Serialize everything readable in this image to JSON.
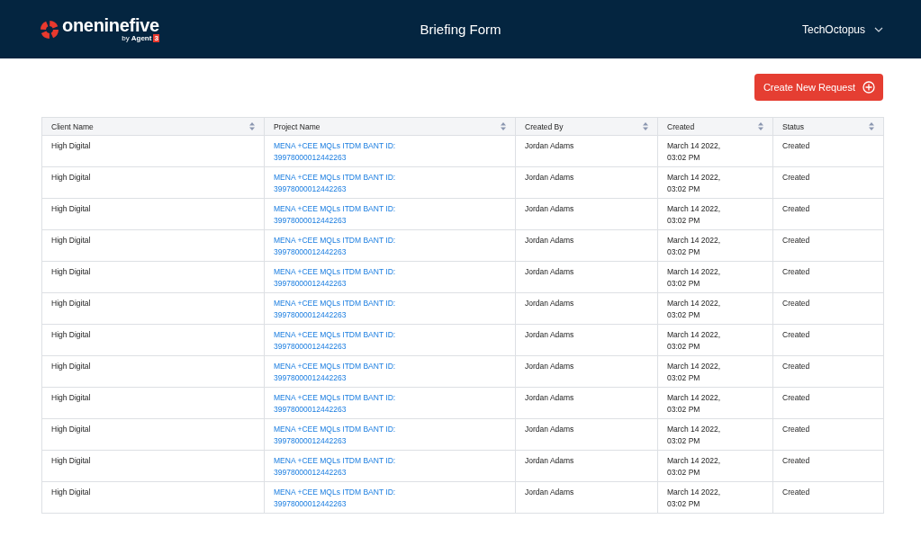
{
  "header": {
    "logo": {
      "wordmark": "oneninefive",
      "byline": "by",
      "brand": "Agent",
      "badge": "3"
    },
    "title": "Briefing Form",
    "user": "TechOctopus"
  },
  "actions": {
    "create_button": "Create New Request"
  },
  "table": {
    "columns": [
      "Client Name",
      "Project Name",
      "Created By",
      "Created",
      "Status"
    ],
    "rows": [
      {
        "client": "High Digital",
        "project": [
          "MENA +CEE MQLs ITDM BANT ID:",
          "39978000012442263"
        ],
        "created_by": "Jordan Adams",
        "created": [
          "March 14 2022,",
          "03:02 PM"
        ],
        "status": "Created"
      },
      {
        "client": "High Digital",
        "project": [
          "MENA +CEE MQLs ITDM BANT ID:",
          "39978000012442263"
        ],
        "created_by": "Jordan Adams",
        "created": [
          "March 14 2022,",
          "03:02 PM"
        ],
        "status": "Created"
      },
      {
        "client": "High Digital",
        "project": [
          "MENA +CEE MQLs ITDM BANT ID:",
          "39978000012442263"
        ],
        "created_by": "Jordan Adams",
        "created": [
          "March 14 2022,",
          "03:02 PM"
        ],
        "status": "Created"
      },
      {
        "client": "High Digital",
        "project": [
          "MENA +CEE MQLs ITDM BANT ID:",
          "39978000012442263"
        ],
        "created_by": "Jordan Adams",
        "created": [
          "March 14 2022,",
          "03:02 PM"
        ],
        "status": "Created"
      },
      {
        "client": "High Digital",
        "project": [
          "MENA +CEE MQLs ITDM BANT ID:",
          "39978000012442263"
        ],
        "created_by": "Jordan Adams",
        "created": [
          "March 14 2022,",
          "03:02 PM"
        ],
        "status": "Created"
      },
      {
        "client": "High Digital",
        "project": [
          "MENA +CEE MQLs ITDM BANT ID:",
          "39978000012442263"
        ],
        "created_by": "Jordan Adams",
        "created": [
          "March 14 2022,",
          "03:02 PM"
        ],
        "status": "Created"
      },
      {
        "client": "High Digital",
        "project": [
          "MENA +CEE MQLs ITDM BANT ID:",
          "39978000012442263"
        ],
        "created_by": "Jordan Adams",
        "created": [
          "March 14 2022,",
          "03:02 PM"
        ],
        "status": "Created"
      },
      {
        "client": "High Digital",
        "project": [
          "MENA +CEE MQLs ITDM BANT ID:",
          "39978000012442263"
        ],
        "created_by": "Jordan Adams",
        "created": [
          "March 14 2022,",
          "03:02 PM"
        ],
        "status": "Created"
      },
      {
        "client": "High Digital",
        "project": [
          "MENA +CEE MQLs ITDM BANT ID:",
          "39978000012442263"
        ],
        "created_by": "Jordan Adams",
        "created": [
          "March 14 2022,",
          "03:02 PM"
        ],
        "status": "Created"
      },
      {
        "client": "High Digital",
        "project": [
          "MENA +CEE MQLs ITDM BANT ID:",
          "39978000012442263"
        ],
        "created_by": "Jordan Adams",
        "created": [
          "March 14 2022,",
          "03:02 PM"
        ],
        "status": "Created"
      },
      {
        "client": "High Digital",
        "project": [
          "MENA +CEE MQLs ITDM BANT ID:",
          "39978000012442263"
        ],
        "created_by": "Jordan Adams",
        "created": [
          "March 14 2022,",
          "03:02 PM"
        ],
        "status": "Created"
      },
      {
        "client": "High Digital",
        "project": [
          "MENA +CEE MQLs ITDM BANT ID:",
          "39978000012442263"
        ],
        "created_by": "Jordan Adams",
        "created": [
          "March 14 2022,",
          "03:02 PM"
        ],
        "status": "Created"
      }
    ]
  }
}
